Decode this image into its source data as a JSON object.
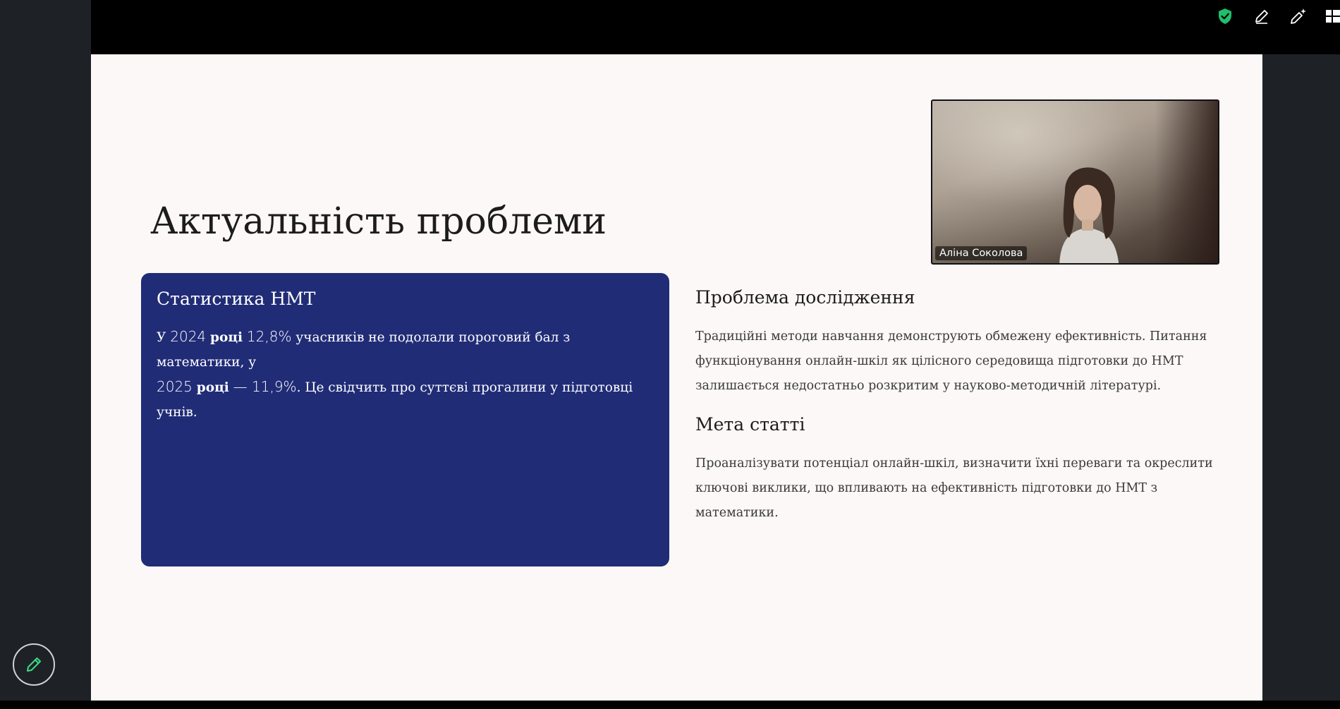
{
  "toolbar": {
    "icons": [
      "shield-check-icon",
      "pen-icon",
      "sparkle-pen-icon",
      "grid-icon"
    ]
  },
  "slide": {
    "title": "Актуальність проблеми",
    "stat_card": {
      "heading": "Статистика НМТ",
      "p1": "У ",
      "year1": "2024",
      "bold1": "році",
      "pct1": "12,8%",
      "p2": "учасників не подолали пороговий бал з математики, у",
      "year2": "2025",
      "bold2": "році",
      "pct2": "— 11,9%",
      "p3": ". Це свідчить про суттєві прогалини у підготовці учнів."
    },
    "problem": {
      "heading": "Проблема дослідження",
      "text": "Традиційні методи навчання демонструють обмежену ефективність. Питання функціонування онлайн-шкіл як цілісного середовища підготовки до НМТ залишається недостатньо розкритим у науково-методичній літературі."
    },
    "goal": {
      "heading": "Мета статті",
      "text": "Проаналізувати потенціал онлайн-шкіл, визначити їхні переваги та окреслити ключові виклики, що впливають на ефективність підготовки до НМТ з математики."
    }
  },
  "video": {
    "participant_name": "Аліна Соколова"
  },
  "colors": {
    "card_bg": "#212c77",
    "slide_bg": "#fcf8f7",
    "shield_green": "#1fbf6b",
    "pen_green": "#3ddc84"
  }
}
